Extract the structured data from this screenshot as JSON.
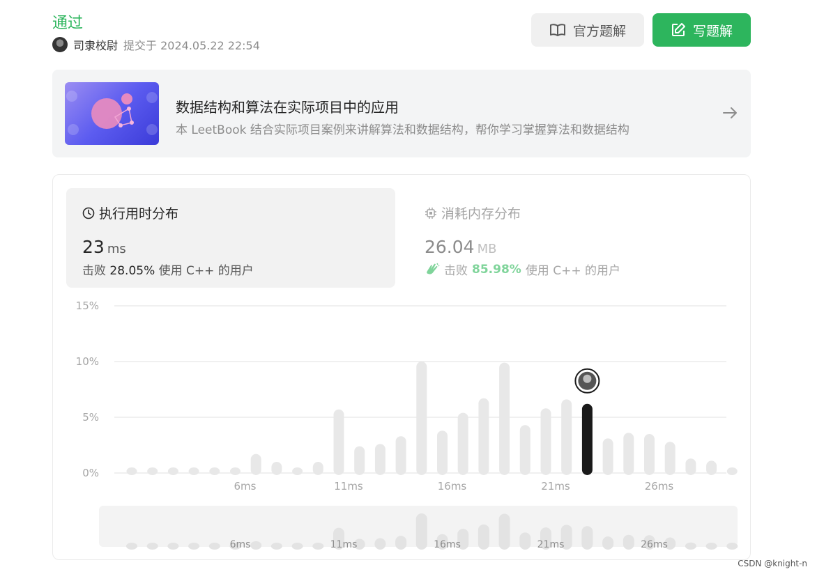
{
  "header": {
    "status": "通过",
    "username": "司隶校尉",
    "submitted": "提交于 2024.05.22 22:54",
    "official_solution_label": "官方题解",
    "write_solution_label": "写题解"
  },
  "book": {
    "title": "数据结构和算法在实际项目中的应用",
    "description": "本 LeetBook 结合实际项目案例来讲解算法和数据结构，帮你学习掌握算法和数据结构"
  },
  "runtime": {
    "title": "执行用时分布",
    "value": "23",
    "unit": "ms",
    "beat_prefix": "击败",
    "beat_pct": "28.05%",
    "beat_suffix": "使用 C++ 的用户"
  },
  "memory": {
    "title": "消耗内存分布",
    "value": "26.04",
    "unit": "MB",
    "beat_prefix": "击败",
    "beat_pct": "85.98%",
    "beat_suffix": "使用 C++ 的用户"
  },
  "chart_data": {
    "type": "bar",
    "ylim": [
      0,
      15
    ],
    "y_ticks": [
      "0%",
      "5%",
      "10%",
      "15%"
    ],
    "x_tick_labels": [
      "6ms",
      "11ms",
      "16ms",
      "21ms",
      "26ms"
    ],
    "x": [
      1,
      2,
      3,
      4,
      5,
      6,
      7,
      8,
      9,
      10,
      11,
      12,
      13,
      14,
      15,
      16,
      17,
      18,
      19,
      20,
      21,
      22,
      23,
      24,
      25,
      26,
      27,
      28,
      29,
      30
    ],
    "values": [
      0.5,
      0.5,
      0.5,
      0.5,
      0.5,
      0.5,
      1.7,
      1.0,
      0.5,
      1.0,
      5.7,
      2.4,
      2.6,
      3.3,
      10.0,
      3.8,
      5.4,
      6.7,
      9.9,
      4.3,
      5.8,
      6.6,
      6.2,
      3.1,
      3.6,
      3.5,
      2.8,
      1.3,
      1.1,
      0.5
    ],
    "highlight_x": 23,
    "colors": {
      "bar": "#e8e8e8",
      "highlight": "#1a1a1a",
      "grid": "#ebebeb",
      "label": "#a6a6a6"
    }
  },
  "watermark": "CSDN @knight-n"
}
